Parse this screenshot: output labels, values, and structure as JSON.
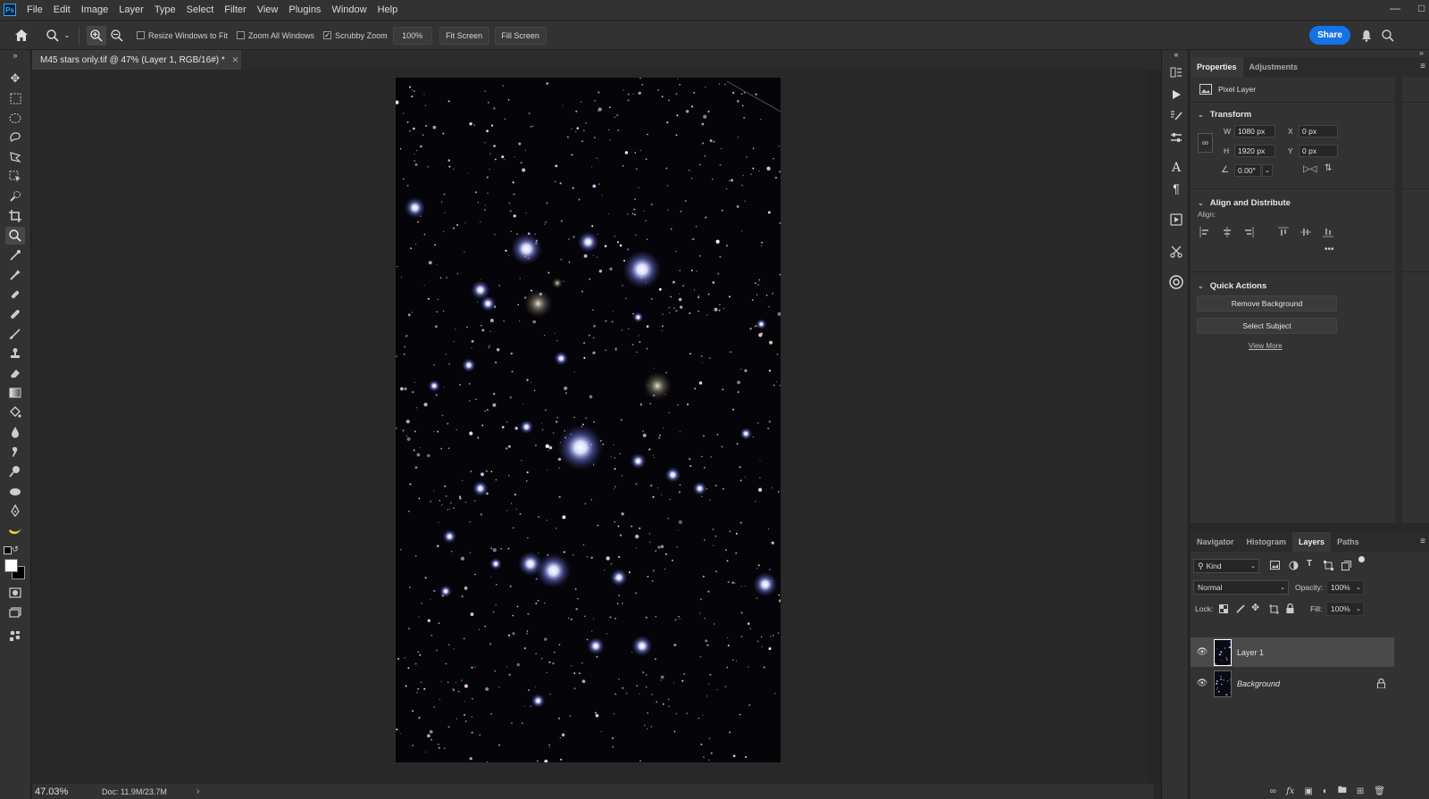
{
  "app": {
    "logo": "Ps"
  },
  "menu": [
    "File",
    "Edit",
    "Image",
    "Layer",
    "Type",
    "Select",
    "Filter",
    "View",
    "Plugins",
    "Window",
    "Help"
  ],
  "options": {
    "resize_windows_label": "Resize Windows to Fit",
    "resize_windows_checked": false,
    "zoom_all_label": "Zoom All Windows",
    "zoom_all_checked": false,
    "scrubby_label": "Scrubby Zoom",
    "scrubby_checked": true,
    "zoom_value": "100%",
    "fit_screen": "Fit Screen",
    "fill_screen": "Fill Screen",
    "share": "Share"
  },
  "document": {
    "tab_title": "M45 stars only.tif @ 47% (Layer 1, RGB/16#) *"
  },
  "status": {
    "zoom": "47.03%",
    "doc_size": "Doc: 11.9M/23.7M"
  },
  "properties": {
    "tab_properties": "Properties",
    "tab_adjustments": "Adjustments",
    "layer_kind": "Pixel Layer",
    "transform_title": "Transform",
    "w_label": "W",
    "w_value": "1080 px",
    "h_label": "H",
    "h_value": "1920 px",
    "x_label": "X",
    "x_value": "0 px",
    "y_label": "Y",
    "y_value": "0 px",
    "angle_value": "0.00°",
    "align_title": "Align and Distribute",
    "align_label": "Align:",
    "quick_actions_title": "Quick Actions",
    "remove_bg": "Remove Background",
    "select_subject": "Select Subject",
    "view_more": "View More"
  },
  "layers_panel": {
    "tabs": [
      "Navigator",
      "Histogram",
      "Layers",
      "Paths"
    ],
    "active_tab": "Layers",
    "filter_kind": "Kind",
    "blend_mode": "Normal",
    "opacity_label": "Opacity:",
    "opacity_value": "100%",
    "lock_label": "Lock:",
    "fill_label": "Fill:",
    "fill_value": "100%",
    "layers": [
      {
        "name": "Layer 1",
        "selected": true,
        "locked": false
      },
      {
        "name": "Background",
        "selected": false,
        "locked": true
      }
    ]
  }
}
